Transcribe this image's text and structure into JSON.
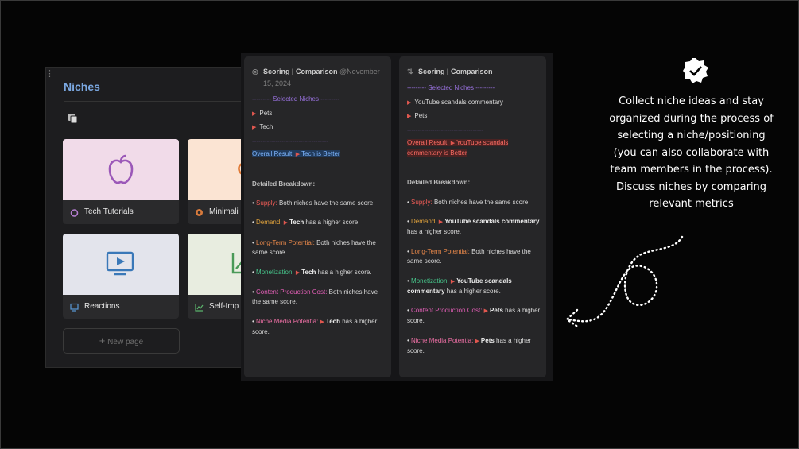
{
  "niches": {
    "title": "Niches",
    "cards": [
      {
        "label": "Tech Tutorials",
        "icon": "apple-icon"
      },
      {
        "label": "Minimali",
        "icon": "spiral-icon"
      },
      {
        "label": "Reactions",
        "icon": "monitor-play-icon"
      },
      {
        "label": "Self-Imp",
        "icon": "chart-icon"
      }
    ],
    "new_page": "New page"
  },
  "scoring_left": {
    "title": "Scoring | Comparison",
    "date_at": "@November",
    "date_rest": "15, 2024",
    "selected_header": "--------- Selected Niches ---------",
    "niches": [
      "Pets",
      "Tech"
    ],
    "separator": "------------------------------------",
    "overall_label": "Overall Result:",
    "overall_value": "Tech  is Better",
    "breakdown_title": "Detailed Breakdown:",
    "supply_key": "Supply:",
    "supply_text": " Both niches have the same score.",
    "demand_key": "Demand:",
    "demand_name": "Tech",
    "demand_text": "  has a higher score.",
    "long_key": "Long-Term Potential:",
    "long_text": " Both niches have the same score.",
    "mon_key": "Monetization:",
    "mon_name": "Tech",
    "mon_text": "  has a higher score.",
    "cpc_key": "Content Production Cost:",
    "cpc_text": " Both niches have the same score.",
    "nmp_key": "Niche Media Potentia:",
    "nmp_name": "Tech",
    "nmp_text": "  has a higher score."
  },
  "scoring_right": {
    "title": "Scoring | Comparison",
    "selected_header": "--------- Selected Niches ---------",
    "niches": [
      "YouTube scandals commentary",
      "Pets"
    ],
    "separator": "------------------------------------",
    "overall_label": "Overall Result:",
    "overall_value": "YouTube scandals commentary  is Better",
    "breakdown_title": "Detailed Breakdown:",
    "supply_key": "Supply:",
    "supply_text": " Both niches have the same score.",
    "demand_key": "Demand:",
    "demand_name": "YouTube scandals commentary",
    "demand_text": " has a higher score.",
    "long_key": "Long-Term Potential:",
    "long_text": " Both niches have the same score.",
    "mon_key": "Monetization:",
    "mon_name": "YouTube scandals commentary",
    "mon_text": "  has a higher score.",
    "cpc_key": "Content Production Cost:",
    "cpc_name": "Pets",
    "cpc_text": "  has a higher score.",
    "nmp_key": "Niche Media Potentia:",
    "nmp_name": "Pets",
    "nmp_text": "  has a higher score."
  },
  "right_text": "Collect niche ideas and stay organized during the process of selecting a niche/positioning (you can also collaborate with team members in the process). Discuss niches by comparing relevant metrics",
  "colors": {
    "accent_blue": "#7aa7e0",
    "purple": "#9a72e0",
    "red": "#ff6d64"
  }
}
